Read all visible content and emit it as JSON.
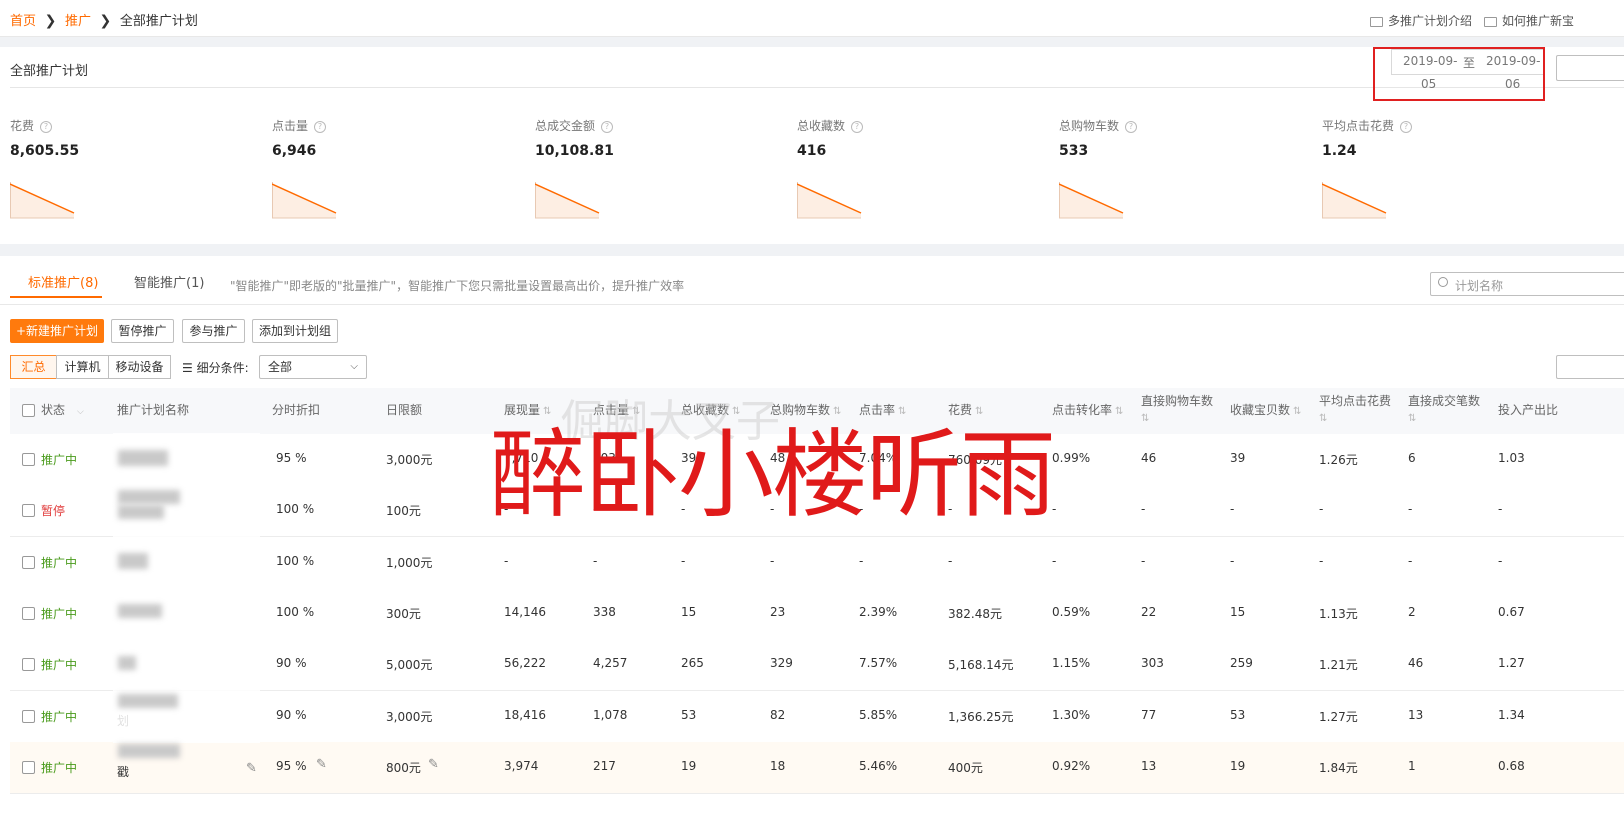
{
  "breadcrumb": {
    "home": "首页",
    "promo": "推广",
    "current": "全部推广计划"
  },
  "top_links": {
    "intro": "多推广计划介绍",
    "howto": "如何推广新宝"
  },
  "panel": {
    "title": "全部推广计划",
    "date_start": [
      "2019-09-",
      "05"
    ],
    "date_to": "至",
    "date_end": [
      "2019-09-",
      "06"
    ]
  },
  "metrics": [
    {
      "label": "花费",
      "value": "8,605.55"
    },
    {
      "label": "点击量",
      "value": "6,946"
    },
    {
      "label": "总成交金额",
      "value": "10,108.81"
    },
    {
      "label": "总收藏数",
      "value": "416"
    },
    {
      "label": "总购物车数",
      "value": "533"
    },
    {
      "label": "平均点击花费",
      "value": "1.24"
    }
  ],
  "tabs": [
    {
      "label": "标准推广(8)",
      "active": true
    },
    {
      "label": "智能推广(1)",
      "active": false
    }
  ],
  "tip": "\"智能推广\"即老版的\"批量推广\"，智能推广下您只需批量设置最高出价，提升推广效率",
  "search": {
    "placeholder": "计划名称"
  },
  "buttons": {
    "new_plan": "+新建推广计划",
    "pause": "暂停推广",
    "join": "参与推广",
    "add_group": "添加到计划组"
  },
  "segments": [
    "汇总",
    "计算机",
    "移动设备"
  ],
  "filter": {
    "label": "细分条件:",
    "value": "全部"
  },
  "table": {
    "headers": {
      "status": "状态",
      "name": "推广计划名称",
      "discount": "分时折扣",
      "daily": "日限额",
      "impressions": "展现量",
      "clicks": "点击量",
      "fav": "总收藏数",
      "cart": "总购物车数",
      "ctr": "点击率",
      "cost": "花费",
      "cvr": "点击转化率",
      "direct_cart": "直接购物车数",
      "fav_items": "收藏宝贝数",
      "avg_cpc": "平均点击花费",
      "direct_orders": "直接成交笔数",
      "roi": "投入产出比"
    },
    "rows": [
      {
        "status": "推广中",
        "on": true,
        "name_suffix": "",
        "discount": "95 %",
        "daily": "3,000元",
        "impressions": "7,710",
        "clicks": "503",
        "fav": "39",
        "cart": "48",
        "ctr": "7.04%",
        "cost": "760.09元",
        "cvr": "0.99%",
        "direct_cart": "46",
        "fav_items": "39",
        "avg_cpc": "1.26元",
        "direct_orders": "6",
        "roi": "1.03"
      },
      {
        "status": "暂停",
        "on": false,
        "name_suffix": "",
        "discount": "100 %",
        "daily": "100元",
        "impressions": "-",
        "clicks": "-",
        "fav": "-",
        "cart": "-",
        "ctr": "-",
        "cost": "-",
        "cvr": "-",
        "direct_cart": "-",
        "fav_items": "-",
        "avg_cpc": "-",
        "direct_orders": "-",
        "roi": "-"
      },
      {
        "status": "推广中",
        "on": true,
        "name_suffix": "",
        "discount": "100 %",
        "daily": "1,000元",
        "impressions": "-",
        "clicks": "-",
        "fav": "-",
        "cart": "-",
        "ctr": "-",
        "cost": "-",
        "cvr": "-",
        "direct_cart": "-",
        "fav_items": "-",
        "avg_cpc": "-",
        "direct_orders": "-",
        "roi": "-"
      },
      {
        "status": "推广中",
        "on": true,
        "name_suffix": "",
        "discount": "100 %",
        "daily": "300元",
        "impressions": "14,146",
        "clicks": "338",
        "fav": "15",
        "cart": "23",
        "ctr": "2.39%",
        "cost": "382.48元",
        "cvr": "0.59%",
        "direct_cart": "22",
        "fav_items": "15",
        "avg_cpc": "1.13元",
        "direct_orders": "2",
        "roi": "0.67"
      },
      {
        "status": "推广中",
        "on": true,
        "name_suffix": "",
        "discount": "90 %",
        "daily": "5,000元",
        "impressions": "56,222",
        "clicks": "4,257",
        "fav": "265",
        "cart": "329",
        "ctr": "7.57%",
        "cost": "5,168.14元",
        "cvr": "1.15%",
        "direct_cart": "303",
        "fav_items": "259",
        "avg_cpc": "1.21元",
        "direct_orders": "46",
        "roi": "1.27"
      },
      {
        "status": "推广中",
        "on": true,
        "name_suffix": "划",
        "discount": "90 %",
        "daily": "3,000元",
        "impressions": "18,416",
        "clicks": "1,078",
        "fav": "53",
        "cart": "82",
        "ctr": "5.85%",
        "cost": "1,366.25元",
        "cvr": "1.30%",
        "direct_cart": "77",
        "fav_items": "53",
        "avg_cpc": "1.27元",
        "direct_orders": "13",
        "roi": "1.34"
      },
      {
        "status": "推广中",
        "on": true,
        "name_suffix": "戳",
        "discount": "95 %",
        "daily": "800元",
        "impressions": "3,974",
        "clicks": "217",
        "fav": "19",
        "cart": "18",
        "ctr": "5.46%",
        "cost": "400元",
        "cvr": "0.92%",
        "direct_cart": "13",
        "fav_items": "19",
        "avg_cpc": "1.84元",
        "direct_orders": "1",
        "roi": "0.68"
      }
    ]
  },
  "watermark": {
    "main": "醉卧小楼听雨",
    "ghost": "倔脚大叉子"
  },
  "colors": {
    "accent": "#ff6a00",
    "active_status": "#4a9b1c",
    "paused_status": "#e03b3b",
    "highlight_box": "#e02020",
    "watermark": "#e01a1a"
  }
}
